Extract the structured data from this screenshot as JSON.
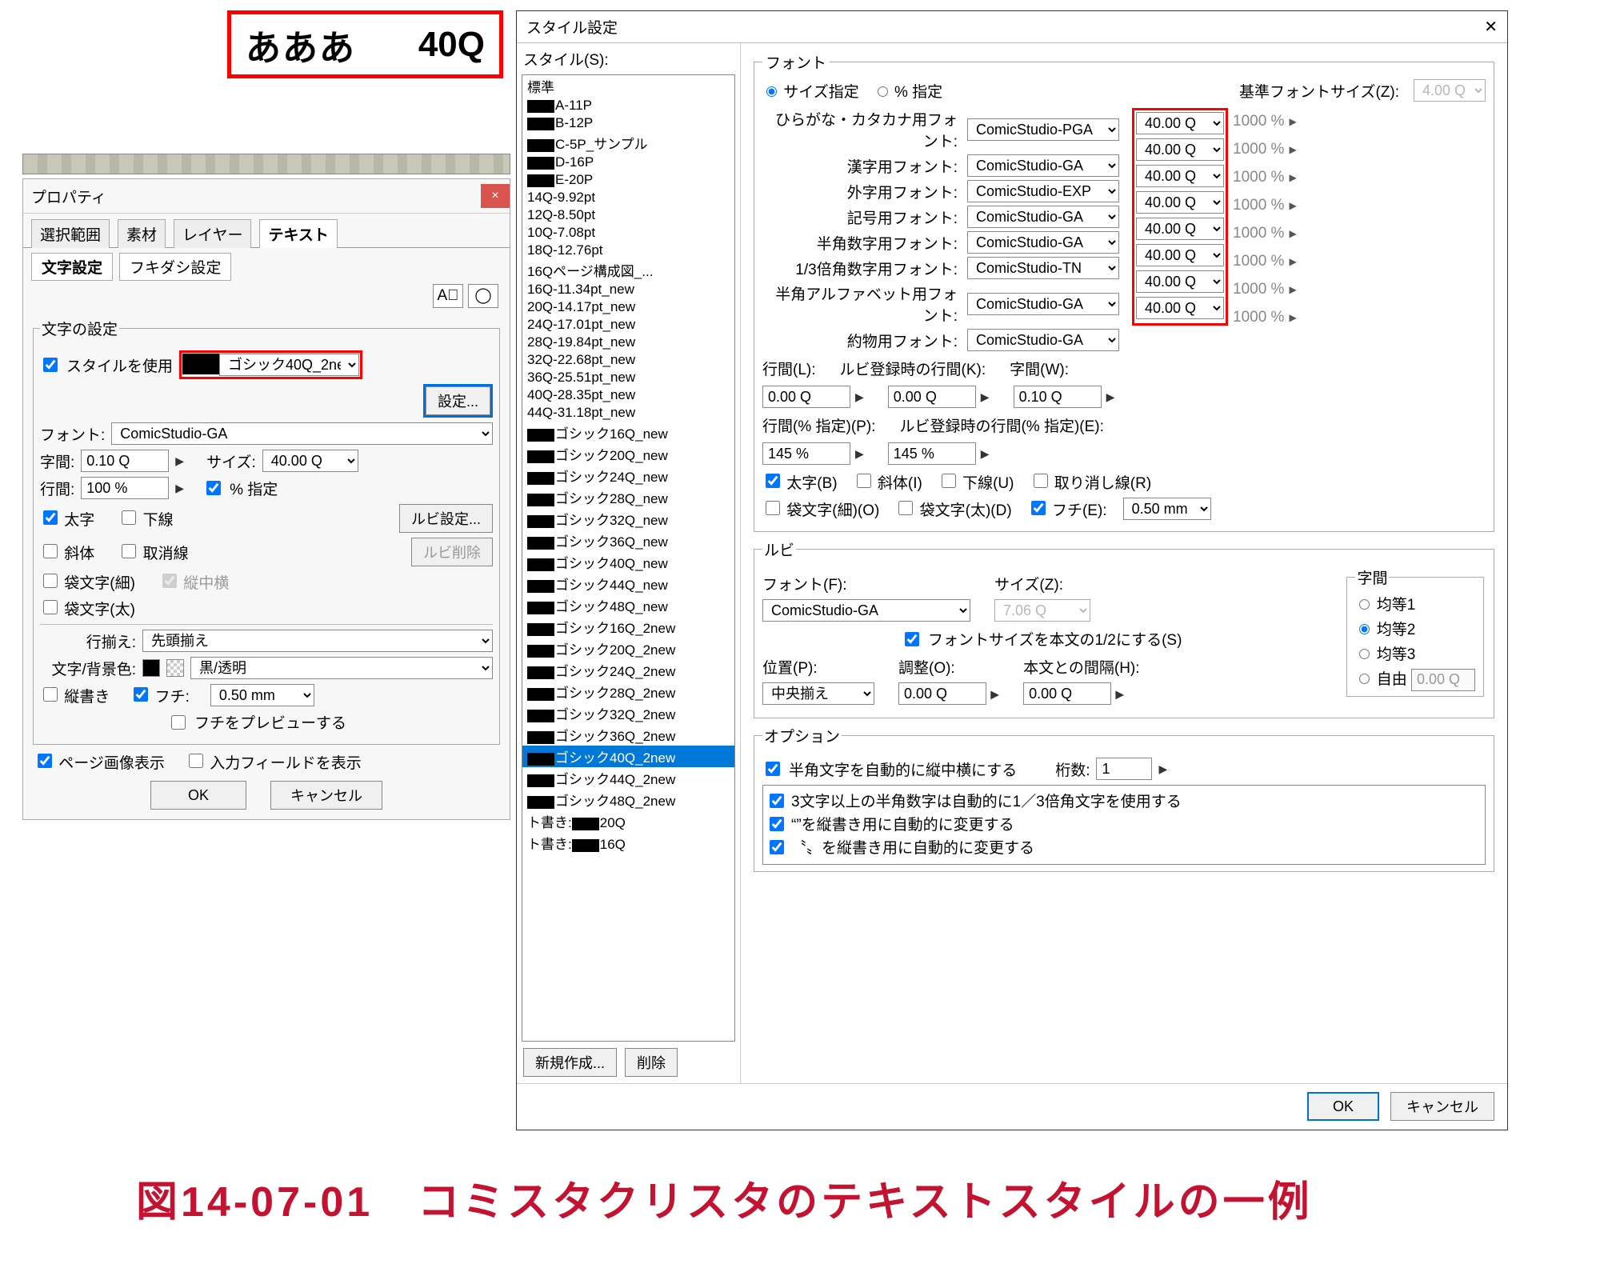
{
  "sample": {
    "text": "あああ",
    "size_label": "40Q"
  },
  "property": {
    "title": "プロパティ",
    "tabs": [
      "選択範囲",
      "素材",
      "レイヤー",
      "テキスト"
    ],
    "active_tab_idx": 3,
    "sub_tabs": [
      "文字設定",
      "フキダシ設定"
    ],
    "active_sub_tab_idx": 0,
    "legend": "文字の設定",
    "use_style_label": "スタイルを使用",
    "use_style_checked": true,
    "style_name": "ゴシック40Q_2ne",
    "settings_btn": "設定...",
    "font_label": "フォント:",
    "font_value": "ComicStudio-GA",
    "jikan_label": "字間:",
    "jikan_value": "0.10 Q",
    "size_label": "サイズ:",
    "size_value": "40.00 Q",
    "gyoukan_label": "行間:",
    "gyoukan_value": "100 %",
    "pct_shitei_label": "% 指定",
    "pct_shitei_checked": true,
    "bold_label": "太字",
    "bold_checked": true,
    "underline_label": "下線",
    "underline_checked": false,
    "italic_label": "斜体",
    "italic_checked": false,
    "strike_label": "取消線",
    "strike_checked": false,
    "fukuro_thin_label": "袋文字(細)",
    "fukuro_thin_checked": false,
    "tatechuu_label": "縦中横",
    "tatechuu_checked": true,
    "fukuro_thick_label": "袋文字(太)",
    "fukuro_thick_checked": false,
    "ruby_settings_btn": "ルビ設定...",
    "ruby_delete_btn": "ルビ削除",
    "align_label": "行揃え:",
    "align_value": "先頭揃え",
    "color_label": "文字/背景色:",
    "color_value": "黒/透明",
    "tategaki_label": "縦書き",
    "tategaki_checked": false,
    "fuchi_label": "フチ:",
    "fuchi_checked": true,
    "fuchi_value": "0.50 mm",
    "fuchi_preview_label": "フチをプレビューする",
    "fuchi_preview_checked": false,
    "page_image_label": "ページ画像表示",
    "page_image_checked": true,
    "input_field_label": "入力フィールドを表示",
    "input_field_checked": false,
    "ok_btn": "OK",
    "cancel_btn": "キャンセル"
  },
  "style_dialog": {
    "title": "スタイル設定",
    "styles_label": "スタイル(S):",
    "styles": [
      "標準",
      "A-11P",
      "B-12P",
      "C-5P_サンプル",
      "D-16P",
      "E-20P",
      "14Q-9.92pt",
      "12Q-8.50pt",
      "10Q-7.08pt",
      "18Q-12.76pt",
      "16Qページ構成図_...",
      "16Q-11.34pt_new",
      "20Q-14.17pt_new",
      "24Q-17.01pt_new",
      "28Q-19.84pt_new",
      "32Q-22.68pt_new",
      "36Q-25.51pt_new",
      "40Q-28.35pt_new",
      "44Q-31.18pt_new",
      "ゴシック16Q_new",
      "ゴシック20Q_new",
      "ゴシック24Q_new",
      "ゴシック28Q_new",
      "ゴシック32Q_new",
      "ゴシック36Q_new",
      "ゴシック40Q_new",
      "ゴシック44Q_new",
      "ゴシック48Q_new",
      "ゴシック16Q_2new",
      "ゴシック20Q_2new",
      "ゴシック24Q_2new",
      "ゴシック28Q_2new",
      "ゴシック32Q_2new",
      "ゴシック36Q_2new",
      "ゴシック40Q_2new",
      "ゴシック44Q_2new",
      "ゴシック48Q_2new",
      "ト書き:　20Q",
      "ト書き:　16Q"
    ],
    "masked_upto": 5,
    "mask_tail_from": 19,
    "selected_idx": 34,
    "new_btn": "新規作成...",
    "delete_btn": "削除",
    "font_legend": "フォント",
    "size_radio_label": "サイズ指定",
    "pct_radio_label": "% 指定",
    "base_size_label": "基準フォントサイズ(Z):",
    "base_size_value": "4.00 Q",
    "font_rows": [
      {
        "label": "ひらがな・カタカナ用フォント:",
        "font": "ComicStudio-PGA",
        "size": "40.00 Q",
        "pct": "1000 %"
      },
      {
        "label": "漢字用フォント:",
        "font": "ComicStudio-GA",
        "size": "40.00 Q",
        "pct": "1000 %"
      },
      {
        "label": "外字用フォント:",
        "font": "ComicStudio-EXP",
        "size": "40.00 Q",
        "pct": "1000 %"
      },
      {
        "label": "記号用フォント:",
        "font": "ComicStudio-GA",
        "size": "40.00 Q",
        "pct": "1000 %"
      },
      {
        "label": "半角数字用フォント:",
        "font": "ComicStudio-GA",
        "size": "40.00 Q",
        "pct": "1000 %"
      },
      {
        "label": "1/3倍角数字用フォント:",
        "font": "ComicStudio-TN",
        "size": "40.00 Q",
        "pct": "1000 %"
      },
      {
        "label": "半角アルファベット用フォント:",
        "font": "ComicStudio-GA",
        "size": "40.00 Q",
        "pct": "1000 %"
      },
      {
        "label": "約物用フォント:",
        "font": "ComicStudio-GA",
        "size": "40.00 Q",
        "pct": "1000 %"
      }
    ],
    "gyoukan_l": "行間(L):",
    "gyoukan_l_val": "0.00 Q",
    "ruby_gyoukan_k": "ルビ登録時の行間(K):",
    "ruby_gyoukan_k_val": "0.00 Q",
    "jikan_w": "字間(W):",
    "jikan_w_val": "0.10 Q",
    "gyoukan_pct_p": "行間(% 指定)(P):",
    "gyoukan_pct_p_val": "145 %",
    "ruby_gyoukan_pct_e": "ルビ登録時の行間(% 指定)(E):",
    "ruby_gyoukan_pct_e_val": "145 %",
    "bold_b": "太字(B)",
    "bold_b_checked": true,
    "italic_i": "斜体(I)",
    "italic_i_checked": false,
    "underline_u": "下線(U)",
    "underline_u_checked": false,
    "strike_r": "取り消し線(R)",
    "strike_r_checked": false,
    "fukuro_thin_o": "袋文字(細)(O)",
    "fukuro_thin_o_checked": false,
    "fukuro_thick_d": "袋文字(太)(D)",
    "fukuro_thick_d_checked": false,
    "fuchi_e": "フチ(E):",
    "fuchi_e_checked": true,
    "fuchi_e_val": "0.50 mm",
    "ruby_legend": "ルビ",
    "ruby_font_label": "フォント(F):",
    "ruby_font_value": "ComicStudio-GA",
    "ruby_size_label": "サイズ(Z):",
    "ruby_size_value": "7.06 Q",
    "ruby_half_label": "フォントサイズを本文の1/2にする(S)",
    "ruby_half_checked": true,
    "ruby_pos_label": "位置(P):",
    "ruby_pos_value": "中央揃え",
    "ruby_adj_label": "調整(O):",
    "ruby_adj_value": "0.00 Q",
    "ruby_gap_label": "本文との間隔(H):",
    "ruby_gap_value": "0.00 Q",
    "jikan_legend": "字間",
    "jikan_radios": [
      "均等1",
      "均等2",
      "均等3",
      "自由"
    ],
    "jikan_radio_sel": 1,
    "jikan_free_val": "0.00 Q",
    "option_legend": "オプション",
    "opt_tatechuu_label": "半角文字を自動的に縦中横にする",
    "opt_tatechuu_checked": true,
    "opt_ketasu_label": "桁数:",
    "opt_ketasu_value": "1",
    "opt_items": [
      {
        "checked": true,
        "label": "3文字以上の半角数字は自動的に1／3倍角文字を使用する"
      },
      {
        "checked": true,
        "label": "“”を縦書き用に自動的に変更する"
      },
      {
        "checked": true,
        "label": "〝〟を縦書き用に自動的に変更する"
      }
    ],
    "ok_btn": "OK",
    "cancel_btn": "キャンセル"
  },
  "caption": "図14-07-01　コミスタクリスタのテキストスタイルの一例"
}
